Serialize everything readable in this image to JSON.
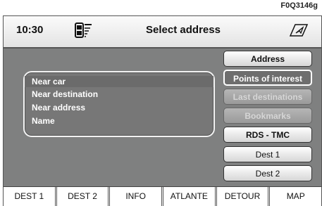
{
  "figure_code": "F0Q3146g",
  "header": {
    "time": "10:30",
    "title": "Select address"
  },
  "list": {
    "items": [
      "Near car",
      "Near destination",
      "Near address",
      "Name"
    ]
  },
  "menu": {
    "items": [
      "Address",
      "Points of interest",
      "Last destinations",
      "Bookmarks",
      "RDS - TMC",
      "Dest 1",
      "Dest 2"
    ]
  },
  "tabs": [
    "DEST 1",
    "DEST 2",
    "INFO",
    "ATLANTE",
    "DETOUR",
    "MAP"
  ],
  "icons": {
    "phone": "phone-signal-icon",
    "navigation": "navigation-arrow-icon"
  }
}
